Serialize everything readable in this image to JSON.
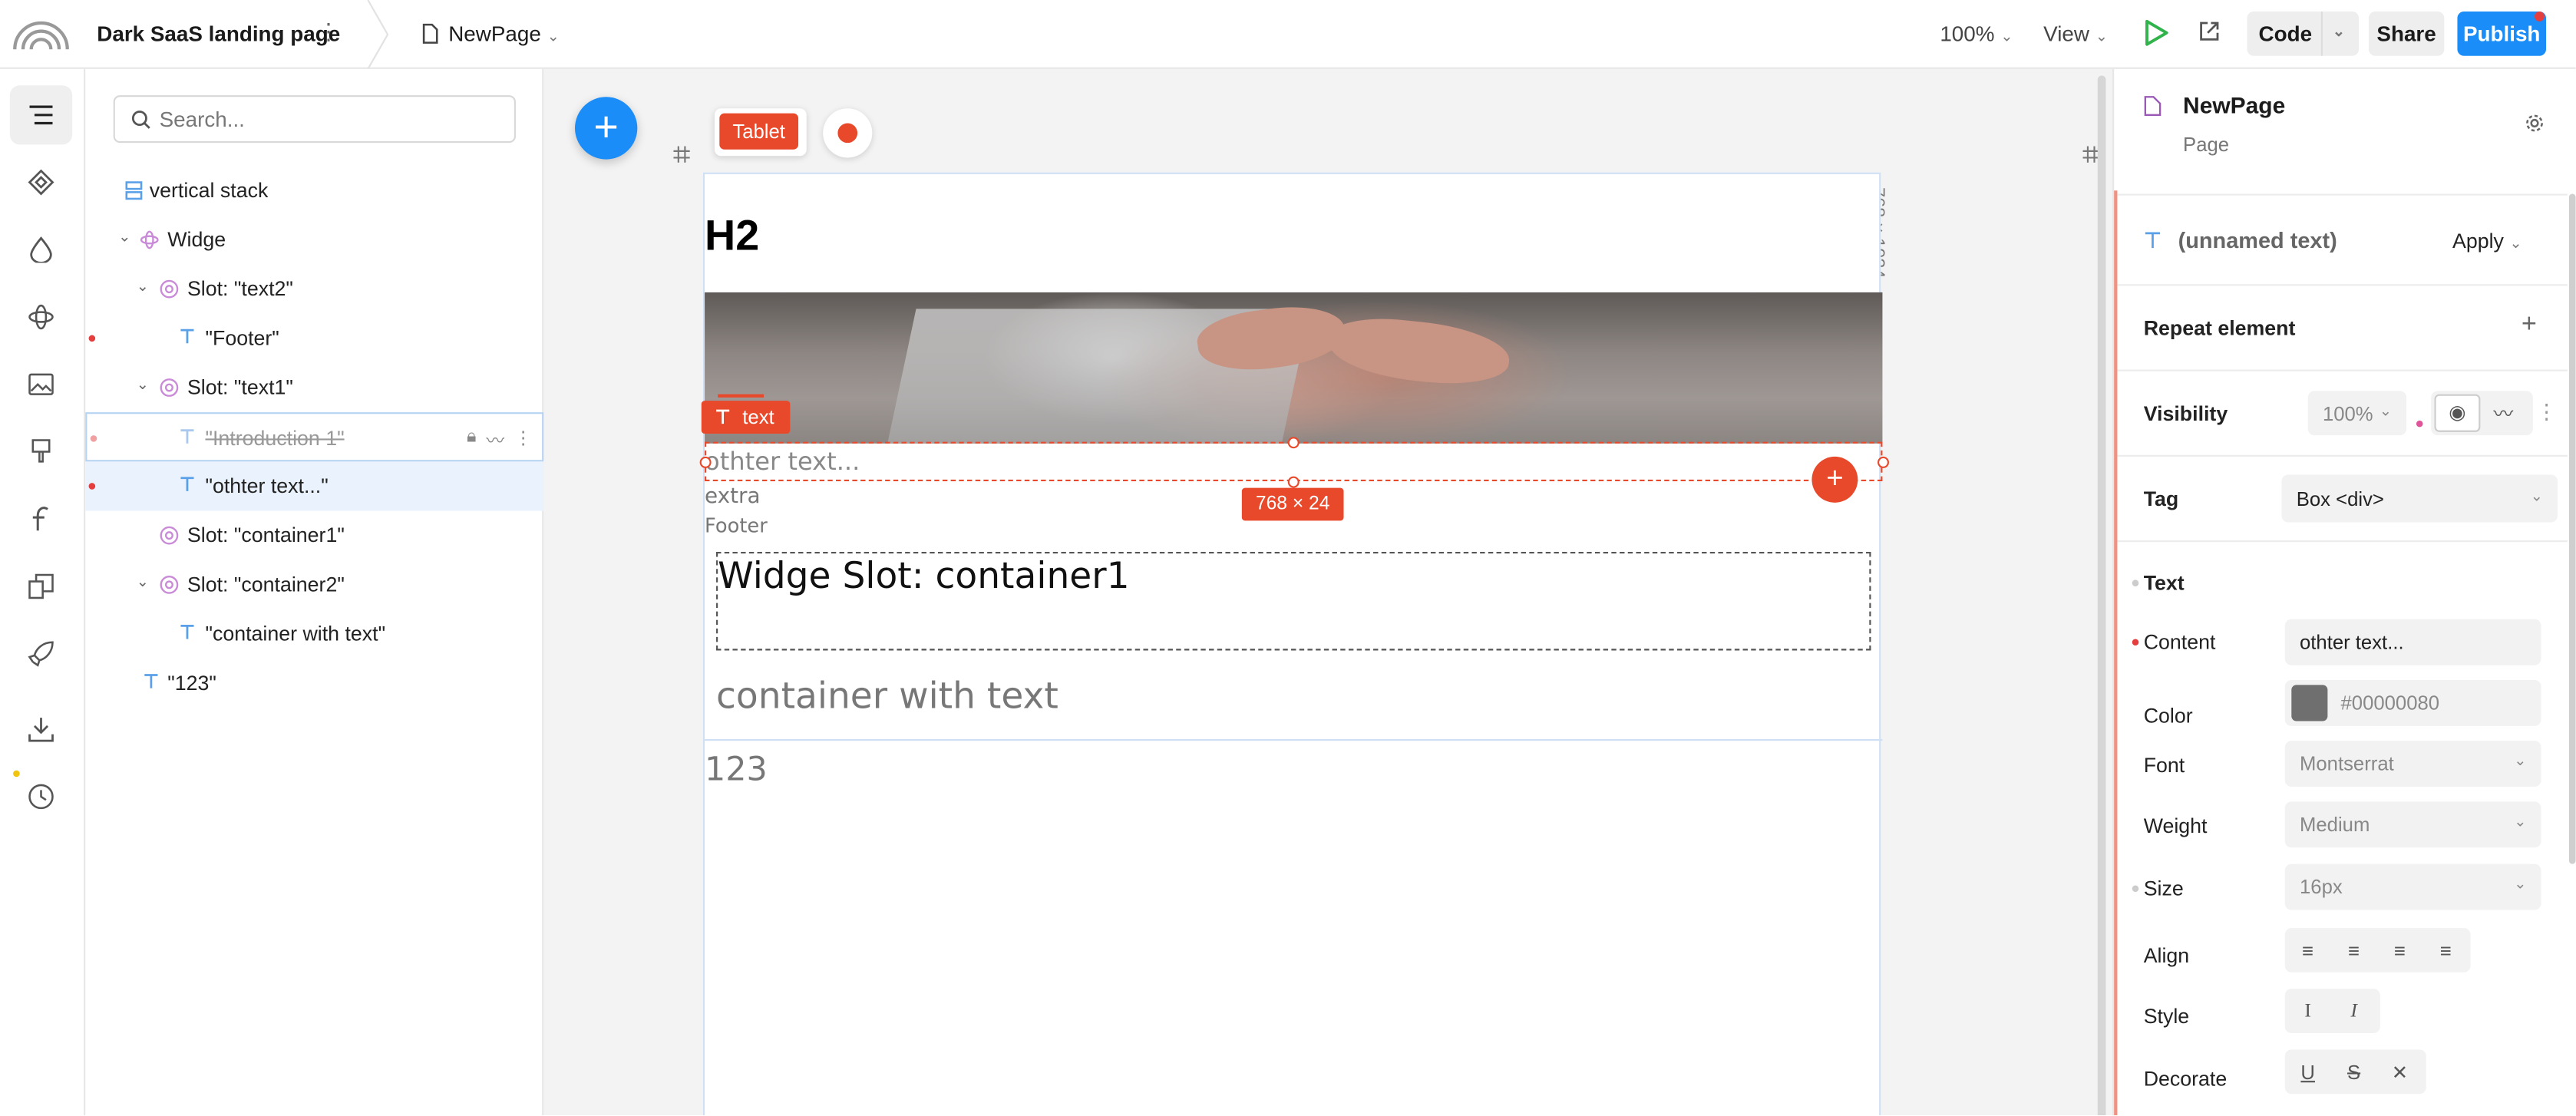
{
  "topbar": {
    "project_title": "Dark SaaS landing page",
    "page_name": "NewPage",
    "zoom": "100%",
    "view": "View",
    "code": "Code",
    "share": "Share",
    "publish": "Publish"
  },
  "layers": {
    "search_placeholder": "Search...",
    "items": [
      {
        "label": "vertical stack"
      },
      {
        "label": "Widge"
      },
      {
        "label": "Slot: \"text2\""
      },
      {
        "label": "\"Footer\""
      },
      {
        "label": "Slot: \"text1\""
      },
      {
        "label": "\"Introduction 1\""
      },
      {
        "label": "\"othter text...\""
      },
      {
        "label": "Slot: \"container1\""
      },
      {
        "label": "Slot: \"container2\""
      },
      {
        "label": "\"container with text\""
      },
      {
        "label": "\"123\""
      }
    ]
  },
  "canvas": {
    "device": "Tablet",
    "dims_vertical": "768 × 1024",
    "h2": "H2",
    "text_tag": "text",
    "othter": "othter text...",
    "extra": "extra",
    "footer": "Footer",
    "dim_badge": "768 × 24",
    "slot_title": "Widge Slot: container1",
    "container_text": "container with text",
    "t123": "123"
  },
  "props": {
    "title": "NewPage",
    "subtitle": "Page",
    "element_name": "(unnamed text)",
    "apply": "Apply",
    "repeat": "Repeat element",
    "visibility": "Visibility",
    "visibility_value": "100%",
    "tag": "Tag",
    "tag_value": "Box <div>",
    "text_section": "Text",
    "content": "Content",
    "content_value": "othter text...",
    "color": "Color",
    "color_value": "#00000080",
    "font": "Font",
    "font_value": "Montserrat",
    "weight": "Weight",
    "weight_value": "Medium",
    "size": "Size",
    "size_value": "16px",
    "align": "Align",
    "style": "Style",
    "decorate": "Decorate"
  },
  "colors": {
    "accent_blue": "#1b8df8",
    "selection_red": "#e8492b"
  }
}
